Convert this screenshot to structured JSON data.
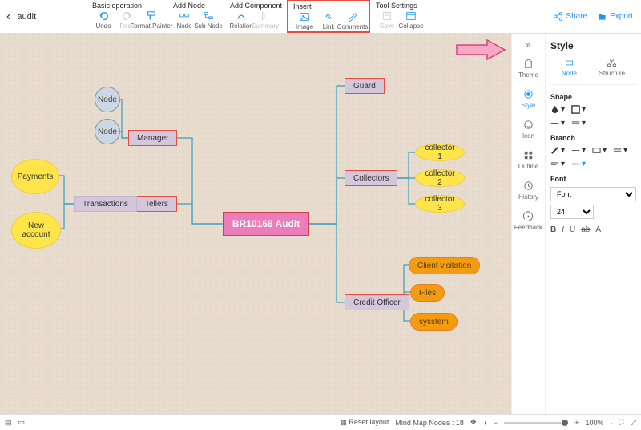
{
  "doc_title": "audit",
  "toolbar": {
    "groups": [
      {
        "title": "Basic operation",
        "items": [
          {
            "id": "undo",
            "label": "Undo",
            "icon": "undo"
          },
          {
            "id": "redo",
            "label": "Redo",
            "icon": "redo",
            "disabled": true
          },
          {
            "id": "format-painter",
            "label": "Format Painter",
            "icon": "brush"
          }
        ]
      },
      {
        "title": "Add Node",
        "items": [
          {
            "id": "node",
            "label": "Node",
            "icon": "node"
          },
          {
            "id": "subnode",
            "label": "Sub Node",
            "icon": "subnode"
          }
        ]
      },
      {
        "title": "Add Component",
        "items": [
          {
            "id": "relation",
            "label": "Relation",
            "icon": "relation"
          },
          {
            "id": "summary",
            "label": "Summary",
            "icon": "summary",
            "disabled": true
          }
        ]
      },
      {
        "title": "Insert",
        "highlight": true,
        "items": [
          {
            "id": "image",
            "label": "Image",
            "icon": "image"
          },
          {
            "id": "link",
            "label": "Link",
            "icon": "link"
          },
          {
            "id": "comments",
            "label": "Comments",
            "icon": "comment"
          }
        ]
      },
      {
        "title": "Tool Settings",
        "items": [
          {
            "id": "save",
            "label": "Save",
            "icon": "save",
            "disabled": true
          },
          {
            "id": "collapse",
            "label": "Collapse",
            "icon": "collapse"
          }
        ]
      }
    ],
    "share": "Share",
    "export": "Export"
  },
  "mindmap": {
    "central": "BR10168 Audit",
    "manager": "Manager",
    "node1": "Node",
    "node2": "Node",
    "tellers": "Tellers",
    "transactions": "Transactions",
    "payments": "Payments",
    "new_account": "New account",
    "guard": "Guard",
    "collectors": "Collectors",
    "c1": "collector 1",
    "c2": "collector 2",
    "c3": "collector 3",
    "credit_officer": "Credit Officer",
    "cv": "Client visitation",
    "files": "Files",
    "sys": "sysstem"
  },
  "rail": {
    "collapse": "»",
    "theme": "Theme",
    "style": "Style",
    "icon": "Icon",
    "outline": "Outline",
    "history": "History",
    "feedback": "Feedback"
  },
  "panel": {
    "title": "Style",
    "tabs": {
      "node": "Node",
      "structure": "Structure"
    },
    "shape": "Shape",
    "branch": "Branch",
    "font": "Font",
    "font_family": "Font",
    "font_size": "24",
    "fmt": {
      "b": "B",
      "i": "I",
      "u": "U",
      "strike": "ab",
      "color": "A"
    }
  },
  "bottom": {
    "reset": "Reset layout",
    "nodes_label": "Mind Map Nodes :",
    "nodes": "18",
    "zoom": "100%"
  }
}
